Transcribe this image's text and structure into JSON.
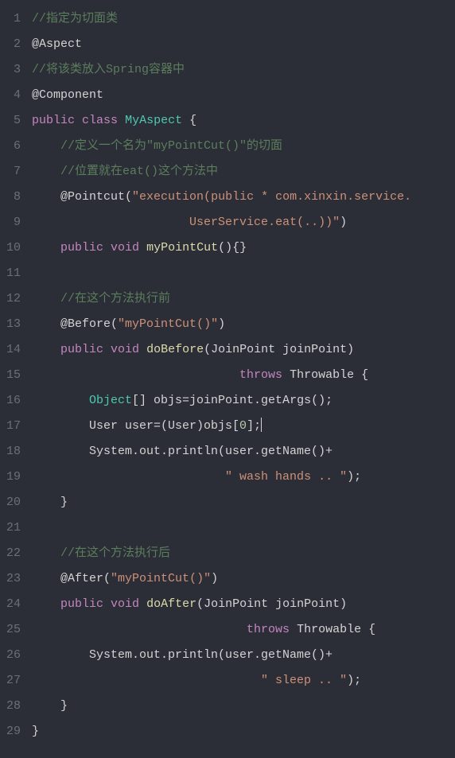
{
  "lineNumbers": [
    "1",
    "2",
    "3",
    "4",
    "5",
    "6",
    "7",
    "8",
    "9",
    "10",
    "11",
    "12",
    "13",
    "14",
    "15",
    "16",
    "17",
    "18",
    "19",
    "20",
    "21",
    "22",
    "23",
    "24",
    "25",
    "26",
    "27",
    "28",
    "29"
  ],
  "code": {
    "lines": [
      [
        {
          "cls": "tok-comment",
          "text": "//指定为切面类"
        }
      ],
      [
        {
          "cls": "tok-annotation",
          "text": "@Aspect"
        }
      ],
      [
        {
          "cls": "tok-comment",
          "text": "//将该类放入Spring容器中"
        }
      ],
      [
        {
          "cls": "tok-annotation",
          "text": "@Component"
        }
      ],
      [
        {
          "cls": "tok-keyword",
          "text": "public"
        },
        {
          "cls": "tok-punct",
          "text": " "
        },
        {
          "cls": "tok-keyword",
          "text": "class"
        },
        {
          "cls": "tok-punct",
          "text": " "
        },
        {
          "cls": "tok-classname",
          "text": "MyAspect"
        },
        {
          "cls": "tok-punct",
          "text": " {"
        }
      ],
      [
        {
          "cls": "tok-punct",
          "text": "    "
        },
        {
          "cls": "tok-comment",
          "text": "//定义一个名为\"myPointCut()\"的切面"
        }
      ],
      [
        {
          "cls": "tok-punct",
          "text": "    "
        },
        {
          "cls": "tok-comment",
          "text": "//位置就在eat()这个方法中"
        }
      ],
      [
        {
          "cls": "tok-punct",
          "text": "    "
        },
        {
          "cls": "tok-annotation",
          "text": "@Pointcut"
        },
        {
          "cls": "tok-punct",
          "text": "("
        },
        {
          "cls": "tok-string",
          "text": "\"execution(public * com.xinxin.service."
        }
      ],
      [
        {
          "cls": "tok-punct",
          "text": "                      "
        },
        {
          "cls": "tok-string",
          "text": "UserService.eat(..))\""
        },
        {
          "cls": "tok-punct",
          "text": ")"
        }
      ],
      [
        {
          "cls": "tok-punct",
          "text": "    "
        },
        {
          "cls": "tok-keyword",
          "text": "public"
        },
        {
          "cls": "tok-punct",
          "text": " "
        },
        {
          "cls": "tok-keyword",
          "text": "void"
        },
        {
          "cls": "tok-punct",
          "text": " "
        },
        {
          "cls": "tok-method",
          "text": "myPointCut"
        },
        {
          "cls": "tok-punct",
          "text": "(){}"
        }
      ],
      [],
      [
        {
          "cls": "tok-punct",
          "text": "    "
        },
        {
          "cls": "tok-comment",
          "text": "//在这个方法执行前"
        }
      ],
      [
        {
          "cls": "tok-punct",
          "text": "    "
        },
        {
          "cls": "tok-annotation",
          "text": "@Before"
        },
        {
          "cls": "tok-punct",
          "text": "("
        },
        {
          "cls": "tok-string",
          "text": "\"myPointCut()\""
        },
        {
          "cls": "tok-punct",
          "text": ")"
        }
      ],
      [
        {
          "cls": "tok-punct",
          "text": "    "
        },
        {
          "cls": "tok-keyword",
          "text": "public"
        },
        {
          "cls": "tok-punct",
          "text": " "
        },
        {
          "cls": "tok-keyword",
          "text": "void"
        },
        {
          "cls": "tok-punct",
          "text": " "
        },
        {
          "cls": "tok-method",
          "text": "doBefore"
        },
        {
          "cls": "tok-punct",
          "text": "(JoinPoint joinPoint)"
        }
      ],
      [
        {
          "cls": "tok-punct",
          "text": "                             "
        },
        {
          "cls": "tok-keyword",
          "text": "throws"
        },
        {
          "cls": "tok-punct",
          "text": " Throwable {"
        }
      ],
      [
        {
          "cls": "tok-punct",
          "text": "        "
        },
        {
          "cls": "tok-classname",
          "text": "Object"
        },
        {
          "cls": "tok-punct",
          "text": "[] objs=joinPoint.getArgs();"
        }
      ],
      [
        {
          "cls": "tok-punct",
          "text": "        User user=(User)objs["
        },
        {
          "cls": "tok-number",
          "text": "0"
        },
        {
          "cls": "tok-punct",
          "text": "];"
        }
      ],
      [
        {
          "cls": "tok-punct",
          "text": "        System.out.println(user.getName()+"
        }
      ],
      [
        {
          "cls": "tok-punct",
          "text": "                           "
        },
        {
          "cls": "tok-string",
          "text": "\" wash hands .. \""
        },
        {
          "cls": "tok-punct",
          "text": ");"
        }
      ],
      [
        {
          "cls": "tok-punct",
          "text": "    }"
        }
      ],
      [],
      [
        {
          "cls": "tok-punct",
          "text": "    "
        },
        {
          "cls": "tok-comment",
          "text": "//在这个方法执行后"
        }
      ],
      [
        {
          "cls": "tok-punct",
          "text": "    "
        },
        {
          "cls": "tok-annotation",
          "text": "@After"
        },
        {
          "cls": "tok-punct",
          "text": "("
        },
        {
          "cls": "tok-string",
          "text": "\"myPointCut()\""
        },
        {
          "cls": "tok-punct",
          "text": ")"
        }
      ],
      [
        {
          "cls": "tok-punct",
          "text": "    "
        },
        {
          "cls": "tok-keyword",
          "text": "public"
        },
        {
          "cls": "tok-punct",
          "text": " "
        },
        {
          "cls": "tok-keyword",
          "text": "void"
        },
        {
          "cls": "tok-punct",
          "text": " "
        },
        {
          "cls": "tok-method",
          "text": "doAfter"
        },
        {
          "cls": "tok-punct",
          "text": "(JoinPoint joinPoint)"
        }
      ],
      [
        {
          "cls": "tok-punct",
          "text": "                              "
        },
        {
          "cls": "tok-keyword",
          "text": "throws"
        },
        {
          "cls": "tok-punct",
          "text": " Throwable {"
        }
      ],
      [
        {
          "cls": "tok-punct",
          "text": "        System.out.println(user.getName()+"
        }
      ],
      [
        {
          "cls": "tok-punct",
          "text": "                                "
        },
        {
          "cls": "tok-string",
          "text": "\" sleep .. \""
        },
        {
          "cls": "tok-punct",
          "text": ");"
        }
      ],
      [
        {
          "cls": "tok-punct",
          "text": "    }"
        }
      ],
      [
        {
          "cls": "tok-punct",
          "text": "}"
        }
      ]
    ]
  },
  "cursorLine": 17
}
